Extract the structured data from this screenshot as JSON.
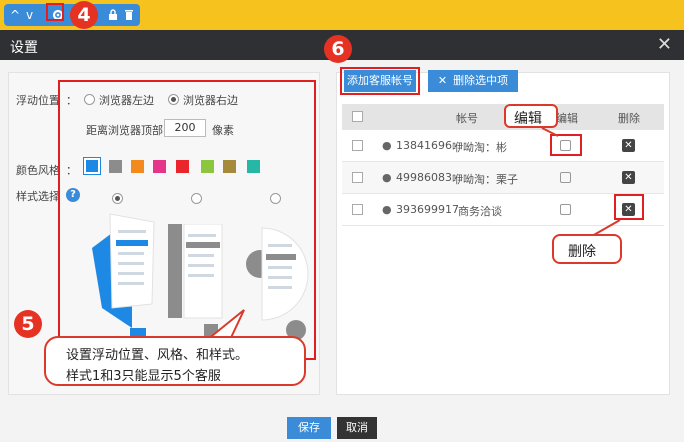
{
  "toolbar": {
    "arrow_up": "^",
    "arrow_down": "v",
    "gear_icon": "gear-icon",
    "lock_icon": "lock-icon",
    "trash_icon": "trash-icon"
  },
  "badges": {
    "step4": "4",
    "step5": "5",
    "step6": "6"
  },
  "dialog": {
    "title": "设置",
    "close": "✕"
  },
  "left": {
    "float_label": "浮动位置",
    "colon": "：",
    "browser_left": "浏览器左边",
    "browser_right": "浏览器右边",
    "dist_label": "距离浏览器顶部",
    "dist_value": "200",
    "dist_unit": "像素",
    "color_label": "颜色风格",
    "style_label": "样式选择",
    "help": "?",
    "callout_line1": "设置浮动位置、风格、和样式。",
    "callout_line2": "样式1和3只能显示5个客服",
    "colors": [
      "#1e88e5",
      "#8c8c8c",
      "#f28a1e",
      "#e6348c",
      "#e8262c",
      "#8cc63f",
      "#a68a3c",
      "#26b7a5"
    ],
    "float_position": "browser_right",
    "selected_style": "style1",
    "selected_color": "#1e88e5"
  },
  "right": {
    "add_btn": "添加客服帐号",
    "del_btn": "删除选中项",
    "del_btn_icon": "✕",
    "col_account": "帐号",
    "col_edit": "编辑",
    "col_delete": "删除",
    "rows": [
      {
        "qq": "13841696",
        "name": "咿呦淘：彬"
      },
      {
        "qq": "49986083",
        "name": "咿呦淘：栗子"
      },
      {
        "qq": "393699917",
        "name": "商务洽谈"
      }
    ],
    "callout_edit": "编辑",
    "callout_delete": "删除"
  },
  "footer": {
    "save": "保存",
    "cancel": "取消"
  }
}
